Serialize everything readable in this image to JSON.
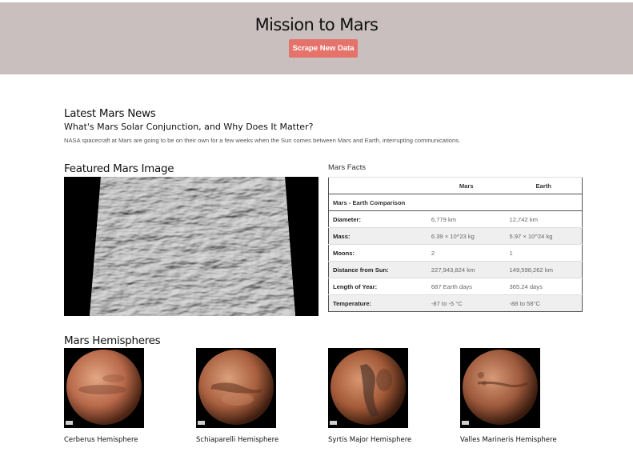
{
  "header": {
    "title": "Mission to Mars",
    "scrape_button": "Scrape New Data"
  },
  "news": {
    "section_title": "Latest Mars News",
    "headline": "What's Mars Solar Conjunction, and Why Does It Matter?",
    "teaser": "NASA spacecraft at Mars are going to be on their own for a few weeks when the Sun comes between Mars and Earth, interrupting communications."
  },
  "featured": {
    "section_title": "Featured Mars Image"
  },
  "facts": {
    "section_title": "Mars Facts",
    "col_mars": "Mars",
    "col_earth": "Earth",
    "comparison": "Mars - Earth Comparison",
    "rows": [
      {
        "label": "Diameter:",
        "mars": "6,779 km",
        "earth": "12,742 km"
      },
      {
        "label": "Mass:",
        "mars": "6.39 × 10^23 kg",
        "earth": "5.97 × 10^24 kg"
      },
      {
        "label": "Moons:",
        "mars": "2",
        "earth": "1"
      },
      {
        "label": "Distance from Sun:",
        "mars": "227,943,824 km",
        "earth": "149,598,262 km"
      },
      {
        "label": "Length of Year:",
        "mars": "687 Earth days",
        "earth": "365.24 days"
      },
      {
        "label": "Temperature:",
        "mars": "-87 to -5 °C",
        "earth": "-88 to 58°C"
      }
    ]
  },
  "hemispheres": {
    "section_title": "Mars Hemispheres",
    "items": [
      {
        "label": "Cerberus Hemisphere"
      },
      {
        "label": "Schiaparelli Hemisphere"
      },
      {
        "label": "Syrtis Major Hemisphere"
      },
      {
        "label": "Valles Marineris Hemisphere"
      }
    ]
  },
  "colors": {
    "header_bg": "#c9bfbf",
    "button_bg": "#e5736b"
  }
}
